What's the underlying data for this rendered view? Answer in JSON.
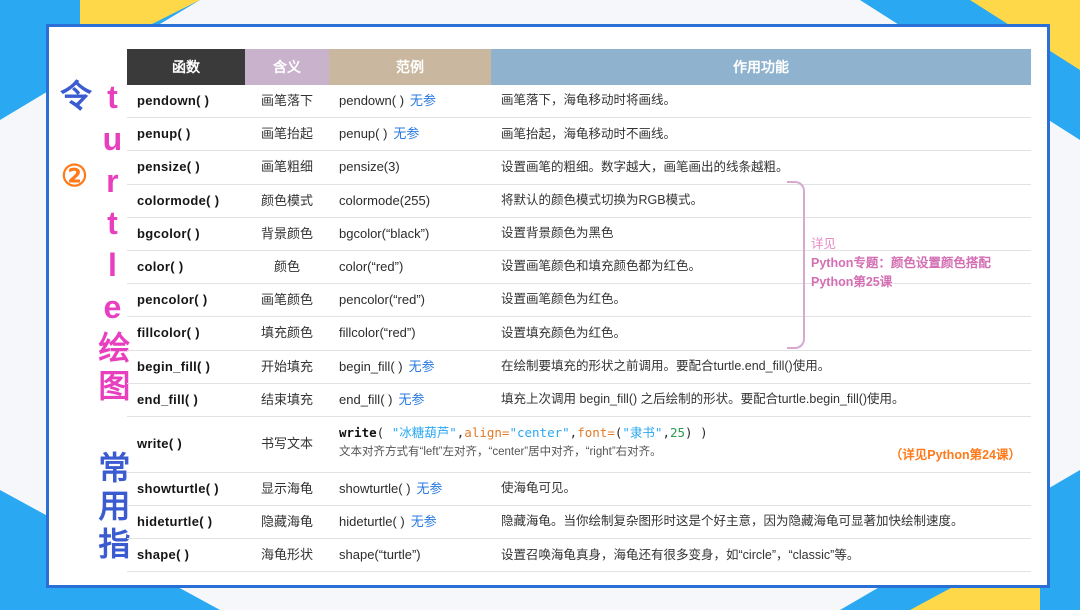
{
  "title": {
    "a": "turtle绘图",
    "b": "常用指令",
    "c": "②"
  },
  "headers": {
    "fn": "函数",
    "mn": "含义",
    "ex": "范例",
    "de": "作用功能"
  },
  "noparam": "无参",
  "sidenote": {
    "head": "详见",
    "l1": "Python专题：颜色设置颜色搭配",
    "l2": "Python第25课"
  },
  "rows": [
    {
      "fn": "pendown( )",
      "mn": "画笔落下",
      "ex": "pendown( )",
      "np": true,
      "de": "画笔落下，海龟移动时将画线。"
    },
    {
      "fn": "penup( )",
      "mn": "画笔抬起",
      "ex": "penup( )",
      "np": true,
      "de": "画笔抬起，海龟移动时不画线。"
    },
    {
      "fn": "pensize( )",
      "mn": "画笔粗细",
      "ex": "pensize(3)",
      "de": "设置画笔的粗细。数字越大，画笔画出的线条越粗。"
    },
    {
      "fn": "colormode( )",
      "mn": "颜色模式",
      "ex": "colormode(255)",
      "de": "将默认的颜色模式切换为RGB模式。"
    },
    {
      "fn": "bgcolor( )",
      "pink": true,
      "mn": "背景颜色",
      "ex": "bgcolor(“black”)",
      "de": "设置背景颜色为黑色"
    },
    {
      "fn": "color( )",
      "pink": true,
      "mn": "颜色",
      "ex": "color(“red”)",
      "de": "设置画笔颜色和填充颜色都为红色。"
    },
    {
      "fn": "pencolor( )",
      "pink": true,
      "mn": "画笔颜色",
      "ex": "pencolor(“red”)",
      "de": "设置画笔颜色为红色。"
    },
    {
      "fn": "fillcolor( )",
      "pink": true,
      "mn": "填充颜色",
      "ex": "fillcolor(“red”)",
      "de": "设置填充颜色为红色。"
    },
    {
      "fn": "begin_fill( )",
      "mn": "开始填充",
      "ex": "begin_fill( )",
      "np": true,
      "de": "在绘制要填充的形状之前调用。要配合turtle.end_fill()使用。"
    },
    {
      "fn": "end_fill( )",
      "mn": "结束填充",
      "ex": "end_fill( )",
      "np": true,
      "de": "填充上次调用 begin_fill() 之后绘制的形状。要配合turtle.begin_fill()使用。"
    },
    {
      "fn": "write( )",
      "mn": "书写文本",
      "special": "write"
    },
    {
      "fn": "showturtle( )",
      "mn": "显示海龟",
      "ex": "showturtle( )",
      "np": true,
      "de": "使海龟可见。"
    },
    {
      "fn": "hideturtle( )",
      "mn": "隐藏海龟",
      "ex": "hideturtle( )",
      "np": true,
      "de": "隐藏海龟。当你绘制复杂图形时这是个好主意，因为隐藏海龟可显著加快绘制速度。"
    },
    {
      "fn": "shape( )",
      "mn": "海龟形状",
      "ex": "shape(“turtle”)",
      "de": "设置召唤海龟真身，海龟还有很多变身，如“circle”，“classic”等。"
    }
  ],
  "write": {
    "code": {
      "fn": "write",
      "s1": "\"冰糖葫芦\"",
      "k1": "align=",
      "s2": "\"center\"",
      "k2": "font=",
      "s3": "\"隶书\"",
      "n": "25"
    },
    "sub": "文本对齐方式有“left”左对齐，“center”居中对齐，“right”右对齐。",
    "note": "（详见Python第24课）"
  }
}
